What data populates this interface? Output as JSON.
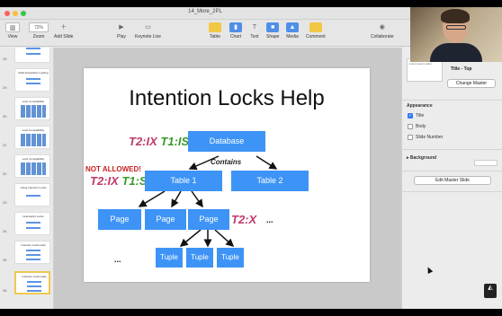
{
  "window": {
    "title": "14_More_2PL"
  },
  "toolbar": {
    "view_label": "View",
    "zoom_label": "Zoom",
    "zoom_value": "72%",
    "add_slide_label": "Add Slide",
    "play_label": "Play",
    "keynote_live_label": "Keynote Live",
    "table_label": "Table",
    "chart_label": "Chart",
    "text_label": "Text",
    "shape_label": "Shape",
    "media_label": "Media",
    "comment_label": "Comment",
    "collaborate_label": "Collaborate"
  },
  "navigator": {
    "slides": [
      {
        "number": "28",
        "title": ""
      },
      {
        "number": "29",
        "title": "Multi-Granularity Locking"
      },
      {
        "number": "30",
        "title": "Lock Compatibility"
      },
      {
        "number": "31",
        "title": "Lock Compatibility"
      },
      {
        "number": "32",
        "title": "Lock Compatibility"
      },
      {
        "number": "33",
        "title": "Using Intention Locks"
      },
      {
        "number": "34",
        "title": "Granularity Locks"
      },
      {
        "number": "35",
        "title": "Intention Locks Help"
      },
      {
        "number": "36",
        "title": "Intention Locks Help"
      }
    ],
    "selected": "36"
  },
  "slide": {
    "title": "Intention Locks Help",
    "nodes": {
      "database": "Database",
      "table1": "Table 1",
      "table2": "Table 2",
      "page1": "Page",
      "page2": "Page",
      "page3": "Page",
      "tuple1": "Tuple",
      "tuple2": "Tuple",
      "tuple3": "Tuple"
    },
    "edge_label": "Contains",
    "locks": {
      "db_t2": "T2:IX",
      "db_t1": "T1:IS",
      "table_t2": "T2:IX",
      "table_t1": "T1:S",
      "page_t2": "T2:X"
    },
    "not_allowed": "NOT ALLOWED!",
    "ellipsis": "..."
  },
  "inspector": {
    "layout_preview_text": "Lorem ipsum dolor",
    "layout_name": "Title - Top",
    "change_master_label": "Change Master",
    "appearance_heading": "Appearance",
    "options": [
      {
        "label": "Title",
        "checked": true
      },
      {
        "label": "Body",
        "checked": false
      },
      {
        "label": "Slide Number",
        "checked": false
      }
    ],
    "background_heading": "Background",
    "edit_master_label": "Edit Master Slide"
  },
  "colors": {
    "node": "#3d94f6",
    "lock_t2": "#c0396b",
    "lock_t1": "#3a9a2a",
    "not_allowed": "#cc1f1f",
    "accent": "#3478f6"
  }
}
